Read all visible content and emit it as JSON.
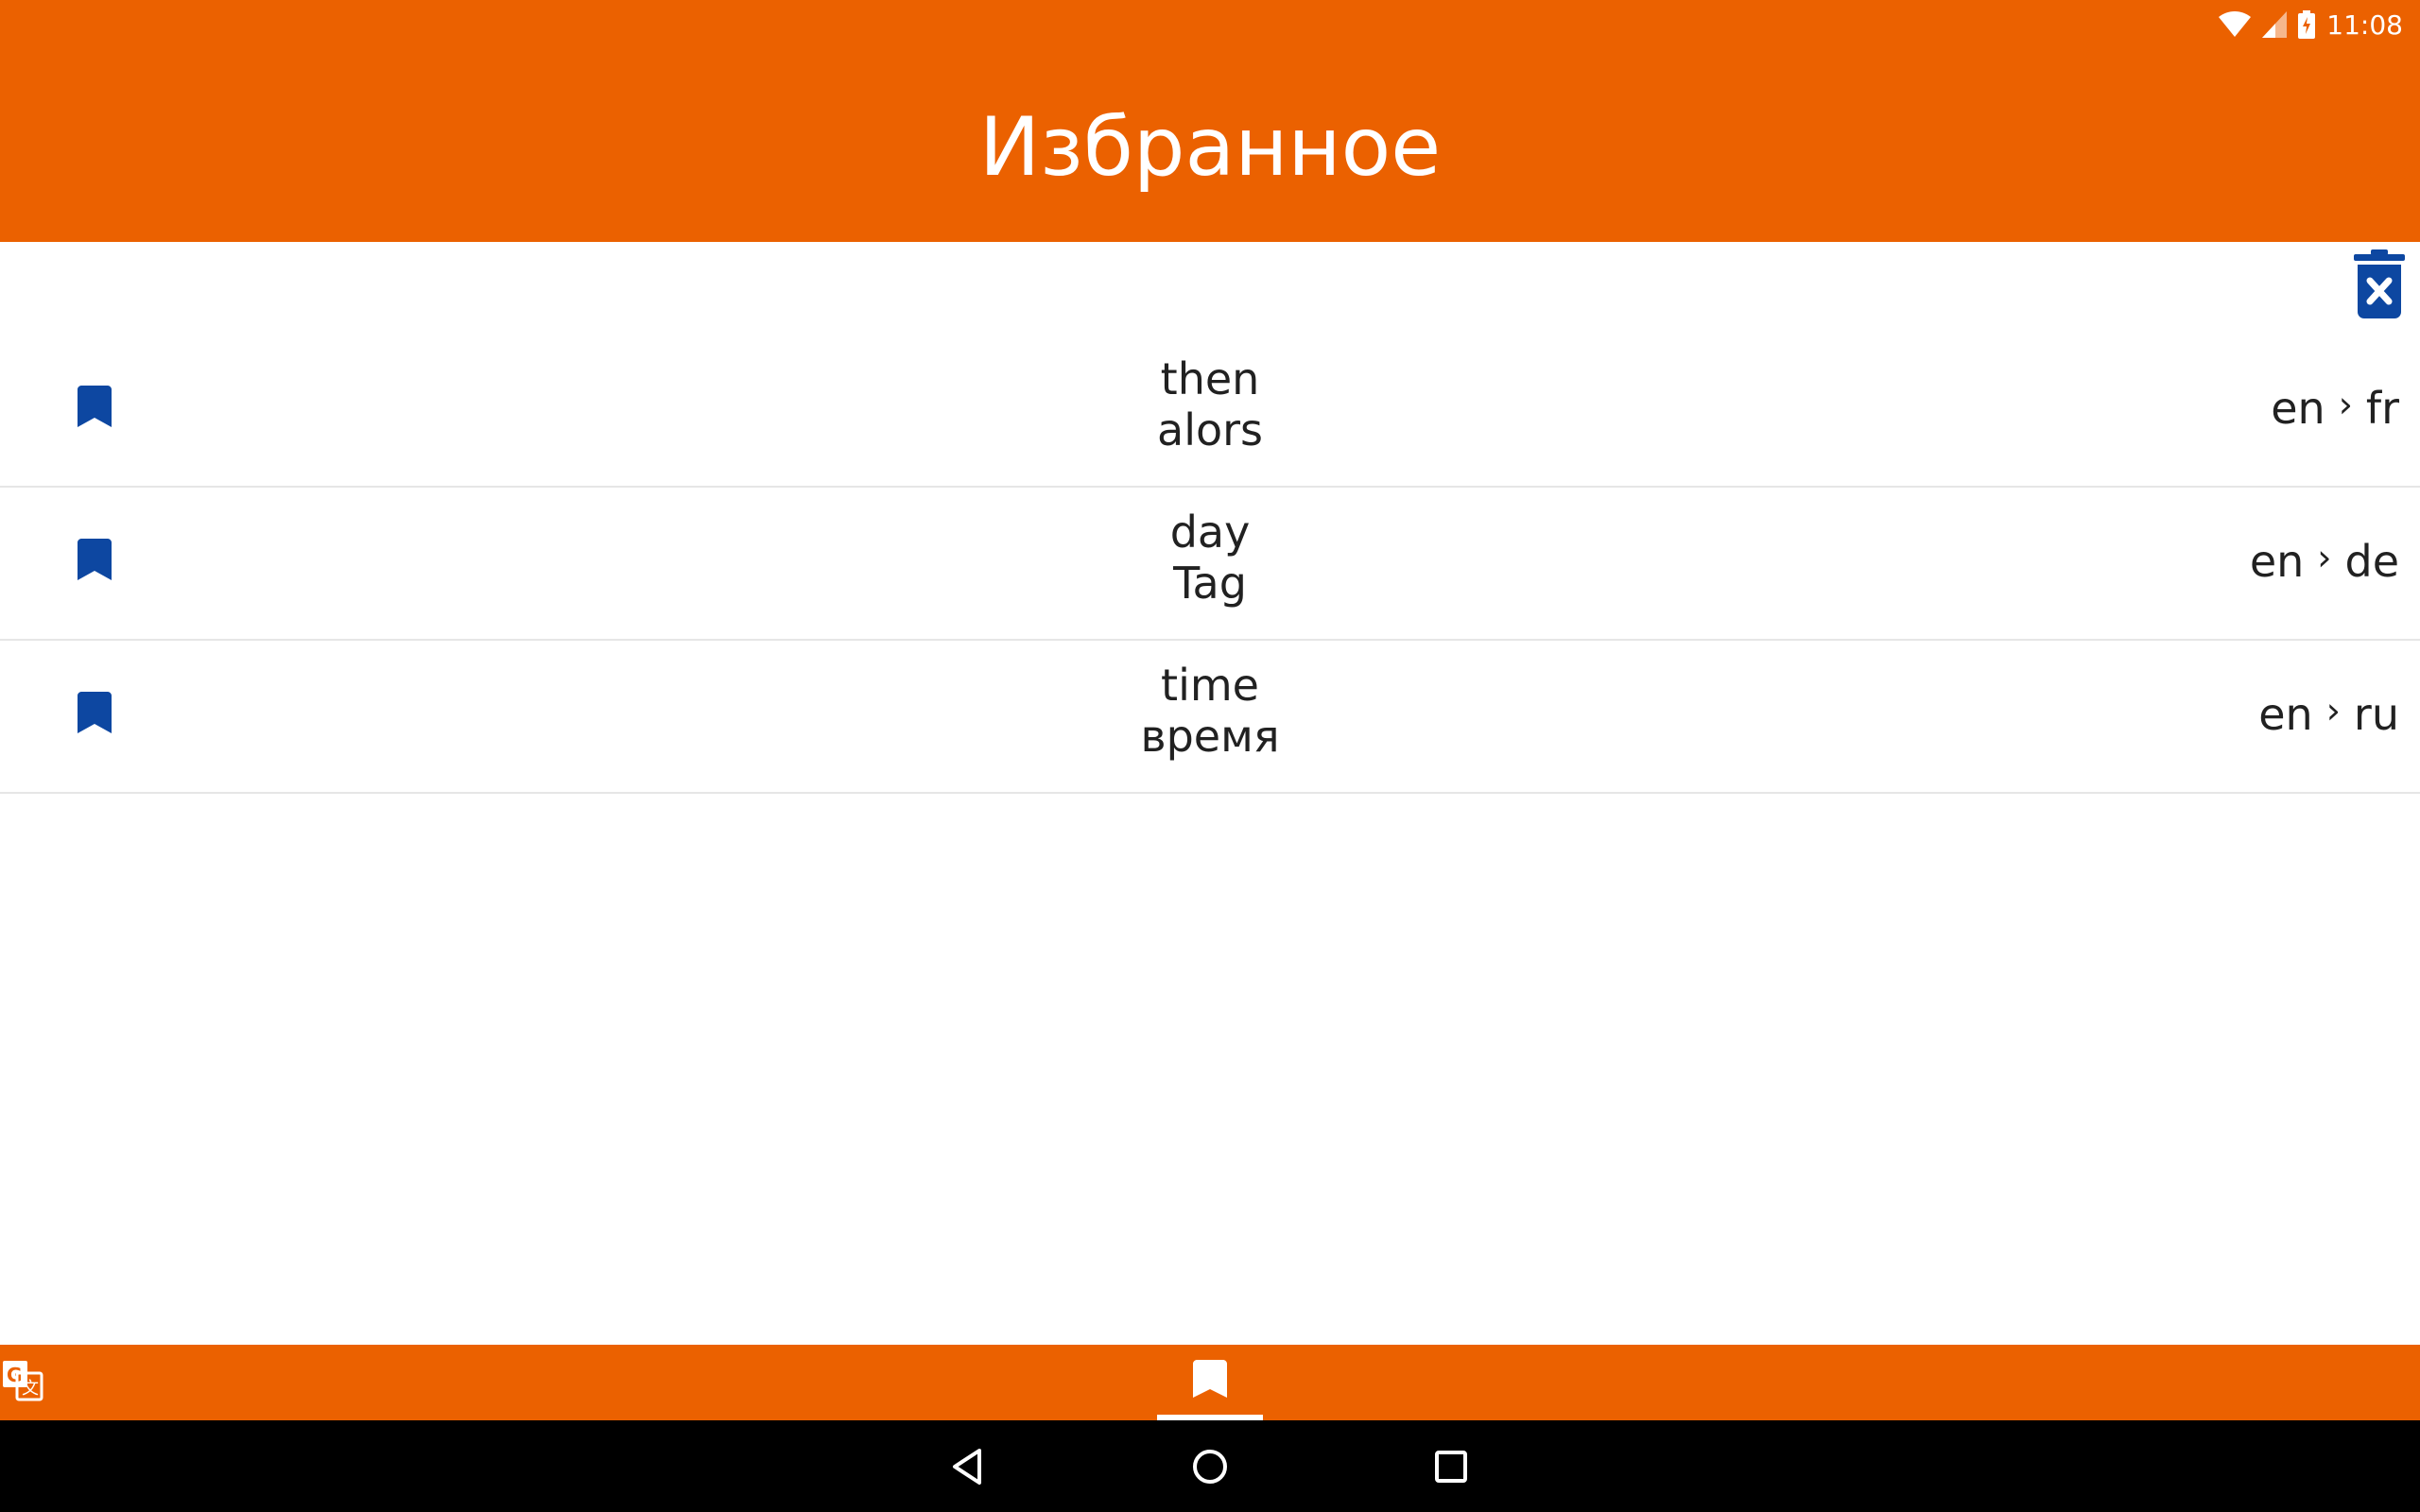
{
  "status_bar": {
    "time": "11:08"
  },
  "header": {
    "title": "Избранное"
  },
  "favorites": [
    {
      "source": "then",
      "translation": "alors",
      "from": "en",
      "to": "fr"
    },
    {
      "source": "day",
      "translation": "Tag",
      "from": "en",
      "to": "de"
    },
    {
      "source": "time",
      "translation": "время",
      "from": "en",
      "to": "ru"
    }
  ],
  "icons": {
    "delete_all": "delete-forever-icon",
    "bookmark": "bookmark-icon",
    "translate": "translate-icon",
    "back": "back-icon",
    "home": "home-icon",
    "recents": "recents-icon"
  },
  "colors": {
    "accent": "#EB6100",
    "icon_blue": "#0D47A1",
    "text": "#212121"
  }
}
